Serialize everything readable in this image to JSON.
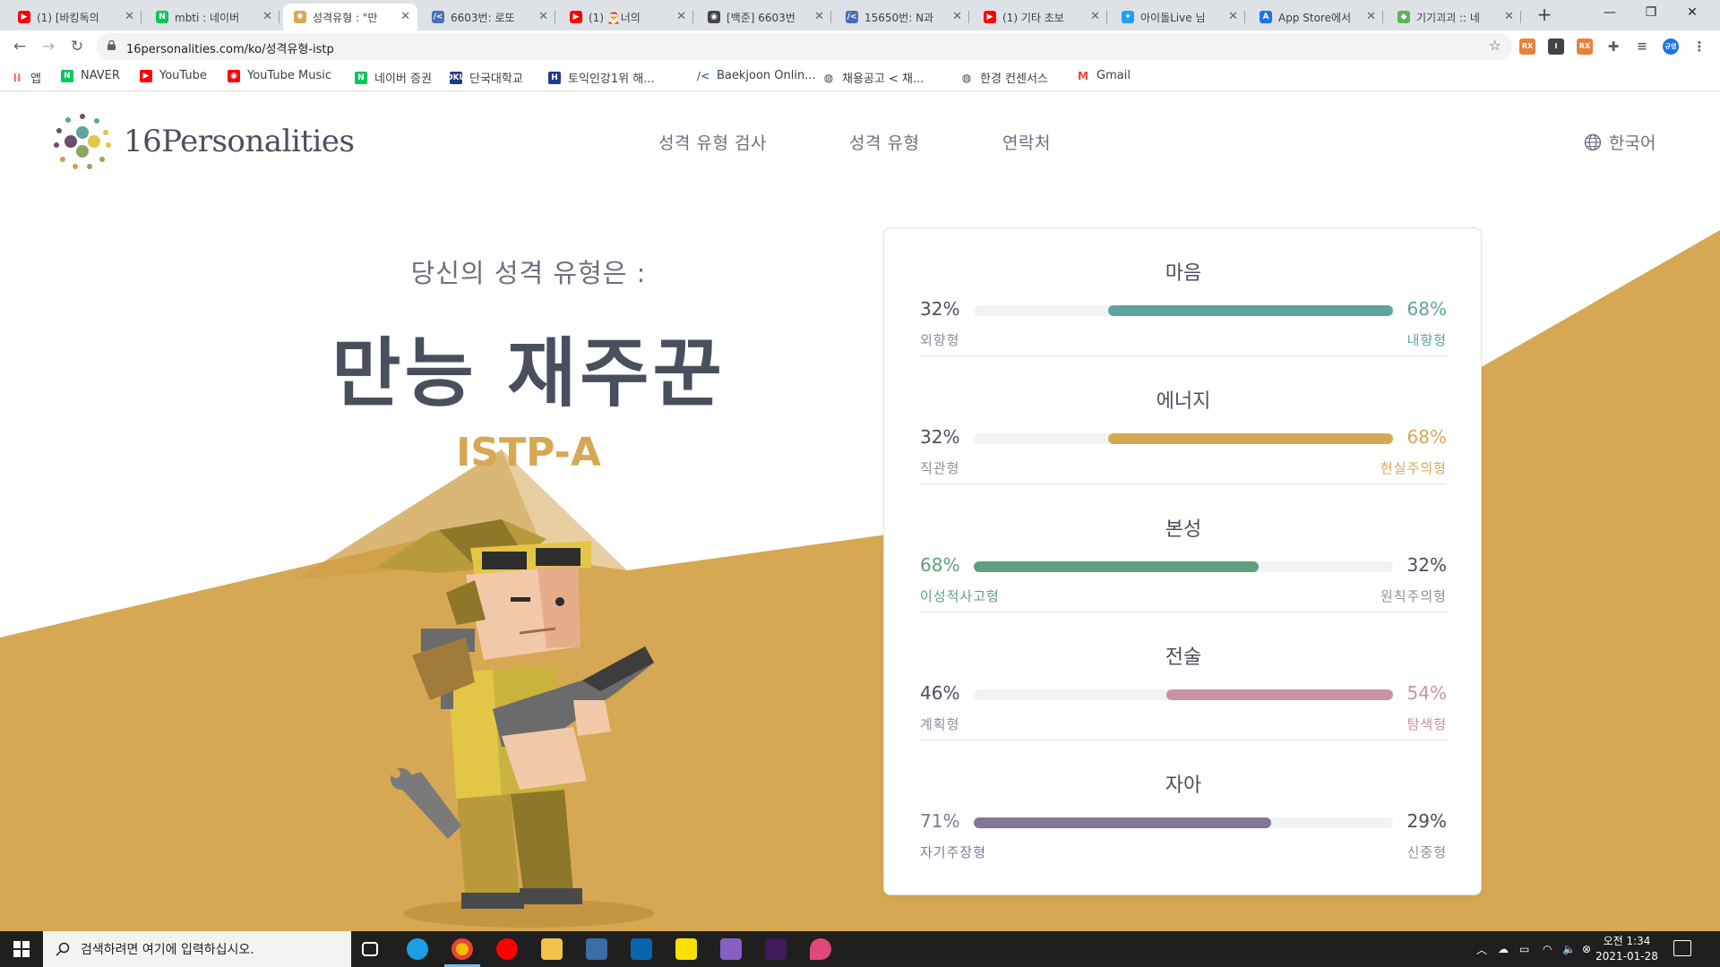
{
  "browser": {
    "tabs": [
      {
        "label": "(1) [바킹독의",
        "favicon_color": "#ff0000",
        "favicon_glyph": "▶",
        "active": false
      },
      {
        "label": "mbti : 네이버",
        "favicon_color": "#03c75a",
        "favicon_glyph": "N",
        "active": false
      },
      {
        "label": "성격유형 : \"만",
        "favicon_color": "#d6a853",
        "favicon_glyph": "✺",
        "active": true
      },
      {
        "label": "6603번: 로또",
        "favicon_color": "#4a6fb5",
        "favicon_glyph": "/<",
        "active": false
      },
      {
        "label": "(1) 🎅너의",
        "favicon_color": "#ff0000",
        "favicon_glyph": "▶",
        "active": false
      },
      {
        "label": "[백준] 6603번",
        "favicon_color": "#444444",
        "favicon_glyph": "◉",
        "active": false
      },
      {
        "label": "15650번: N과",
        "favicon_color": "#4a6fb5",
        "favicon_glyph": "/<",
        "active": false
      },
      {
        "label": "(1) 기타 초보",
        "favicon_color": "#ff0000",
        "favicon_glyph": "▶",
        "active": false
      },
      {
        "label": "아이돌Live 님",
        "favicon_color": "#1da1f2",
        "favicon_glyph": "✦",
        "active": false
      },
      {
        "label": "App Store에서",
        "favicon_color": "#1a73e8",
        "favicon_glyph": "A",
        "active": false
      },
      {
        "label": "기기괴괴 :: 네",
        "favicon_color": "#5fb157",
        "favicon_glyph": "◆",
        "active": false
      }
    ],
    "url": "16personalities.com/ko/성격유형-istp",
    "bookmarks": [
      {
        "label": "앱",
        "icon": "apps-grid-icon",
        "color": "#ea4335"
      },
      {
        "label": "NAVER",
        "icon": "naver-icon",
        "color": "#03c75a"
      },
      {
        "label": "YouTube",
        "icon": "youtube-icon",
        "color": "#ff0000"
      },
      {
        "label": "YouTube Music",
        "icon": "youtube-music-icon",
        "color": "#ff0000"
      },
      {
        "label": "네이버 증권",
        "icon": "naver-icon",
        "color": "#03c75a"
      },
      {
        "label": "단국대학교",
        "icon": "dku-icon",
        "color": "#1e3a8a"
      },
      {
        "label": "토익인강1위 해...",
        "icon": "hackers-icon",
        "color": "#1e3a8a"
      },
      {
        "label": "Baekjoon Onlin...",
        "icon": "baekjoon-icon",
        "color": "#4a6fb5"
      },
      {
        "label": "채용공고 < 채...",
        "icon": "globe-icon",
        "color": "#444444"
      },
      {
        "label": "한경 컨센서스",
        "icon": "globe-icon",
        "color": "#444444"
      },
      {
        "label": "Gmail",
        "icon": "gmail-icon",
        "color": "#ea4335"
      }
    ],
    "profile_initials": "규영"
  },
  "site": {
    "logo_text": "16Personalities",
    "nav": [
      "성격 유형 검사",
      "성격 유형",
      "연락처"
    ],
    "language": "한국어"
  },
  "result": {
    "intro": "당신의 성격 유형은 :",
    "type_name": "만능 재주꾼",
    "type_code": "ISTP-A"
  },
  "traits": [
    {
      "title": "마음",
      "left_pct": "32%",
      "right_pct": "68%",
      "left_label": "외향형",
      "right_label": "내향형",
      "value": 0.68,
      "dominant": "right",
      "color": "#5fa39f"
    },
    {
      "title": "에너지",
      "left_pct": "32%",
      "right_pct": "68%",
      "left_label": "직관형",
      "right_label": "현실주의형",
      "value": 0.68,
      "dominant": "right",
      "color": "#d6a853"
    },
    {
      "title": "본성",
      "left_pct": "68%",
      "right_pct": "32%",
      "left_label": "이성적사고형",
      "right_label": "원칙주의형",
      "value": 0.68,
      "dominant": "left",
      "color": "#5f9e7e"
    },
    {
      "title": "전술",
      "left_pct": "46%",
      "right_pct": "54%",
      "left_label": "계획형",
      "right_label": "탐색형",
      "value": 0.54,
      "dominant": "right",
      "color": "#c891a6"
    },
    {
      "title": "자아",
      "left_pct": "71%",
      "right_pct": "29%",
      "left_label": "자기주장형",
      "right_label": "신중형",
      "value": 0.71,
      "dominant": "left",
      "color": "#857596"
    }
  ],
  "taskbar": {
    "search_placeholder": "검색하려면 여기에 입력하십시오.",
    "time": "오전 1:34",
    "date": "2021-01-28"
  }
}
